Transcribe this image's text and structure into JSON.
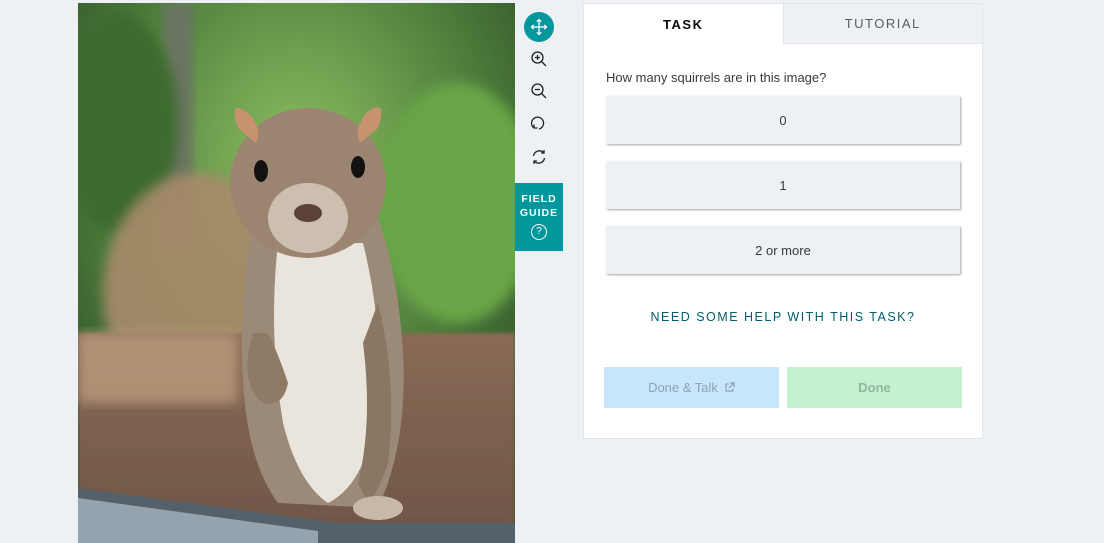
{
  "subject": {
    "alt": "A gray squirrel standing upright behind glass",
    "colors": {
      "foliage": "#5d8a4a",
      "fur": "#9b8a77",
      "belly": "#e9e4dc"
    }
  },
  "toolbar": {
    "tools": [
      {
        "name": "move-tool",
        "icon": "arrows-move-icon",
        "active": true
      },
      {
        "name": "zoom-in-tool",
        "icon": "zoom-in-icon",
        "active": false
      },
      {
        "name": "zoom-out-tool",
        "icon": "zoom-out-icon",
        "active": false
      },
      {
        "name": "rotate-tool",
        "icon": "rotate-icon",
        "active": false
      },
      {
        "name": "reset-tool",
        "icon": "refresh-icon",
        "active": false
      }
    ],
    "field_guide_label": "FIELD\nGUIDE",
    "field_guide_icon": "?",
    "accent": "#00979d"
  },
  "tabs": {
    "task": "TASK",
    "tutorial": "TUTORIAL"
  },
  "task": {
    "question": "How many squirrels are in this image?",
    "answers": [
      "0",
      "1",
      "2 or more"
    ],
    "help_link": "NEED SOME HELP WITH THIS TASK?"
  },
  "actions": {
    "done_talk": "Done & Talk",
    "done": "Done"
  }
}
